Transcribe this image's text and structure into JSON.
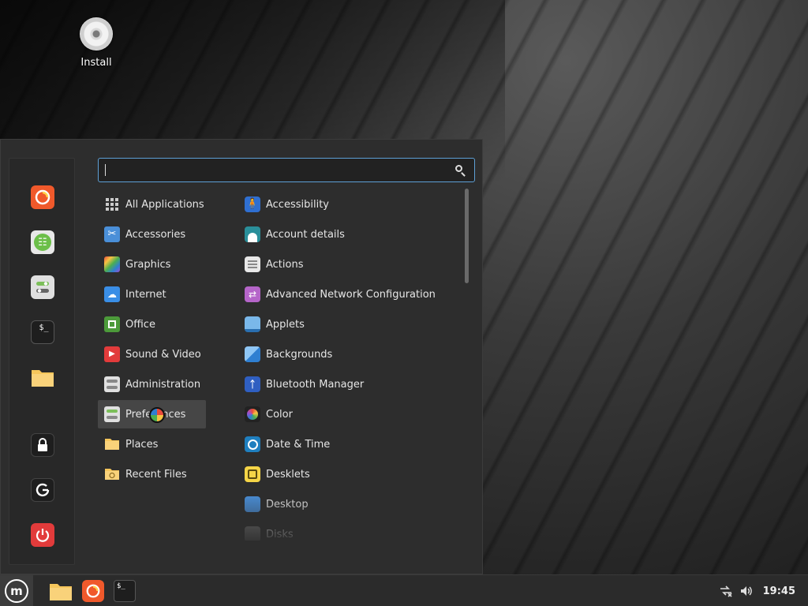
{
  "desktop": {
    "icons": [
      {
        "label": "Install",
        "icon": "disc-icon"
      }
    ]
  },
  "search": {
    "value": "",
    "placeholder": ""
  },
  "favorites": [
    {
      "name": "firefox",
      "icon": "firefox-icon",
      "color": "#f0592b"
    },
    {
      "name": "software-manager",
      "icon": "software-manager-icon",
      "color": "#6cbf49"
    },
    {
      "name": "system-settings",
      "icon": "settings-toggle-icon",
      "color": "#e0e0e0"
    },
    {
      "name": "terminal",
      "icon": "terminal-icon",
      "color": "#1e1e1e"
    },
    {
      "name": "files",
      "icon": "folder-icon",
      "color": "#f6c65b"
    },
    {
      "name": "lock-screen",
      "icon": "lock-icon",
      "color": "#1e1e1e"
    },
    {
      "name": "logout",
      "icon": "logout-icon",
      "color": "#1e1e1e"
    },
    {
      "name": "shutdown",
      "icon": "power-icon",
      "color": "#e23b3b"
    }
  ],
  "categories": [
    {
      "label": "All Applications",
      "icon": "grid-icon"
    },
    {
      "label": "Accessories",
      "icon": "scissors-icon"
    },
    {
      "label": "Graphics",
      "icon": "graphics-icon"
    },
    {
      "label": "Internet",
      "icon": "cloud-icon"
    },
    {
      "label": "Office",
      "icon": "office-icon"
    },
    {
      "label": "Sound & Video",
      "icon": "play-icon"
    },
    {
      "label": "Administration",
      "icon": "admin-toggle-icon"
    },
    {
      "label": "Preferences",
      "icon": "preferences-toggle-icon",
      "selected": true
    },
    {
      "label": "Places",
      "icon": "folder-icon"
    },
    {
      "label": "Recent Files",
      "icon": "recent-folder-icon"
    }
  ],
  "apps": [
    {
      "label": "Accessibility",
      "icon": "accessibility-icon"
    },
    {
      "label": "Account details",
      "icon": "account-icon"
    },
    {
      "label": "Actions",
      "icon": "actions-icon"
    },
    {
      "label": "Advanced Network Configuration",
      "icon": "network-icon"
    },
    {
      "label": "Applets",
      "icon": "applets-icon"
    },
    {
      "label": "Backgrounds",
      "icon": "backgrounds-icon"
    },
    {
      "label": "Bluetooth Manager",
      "icon": "bluetooth-icon"
    },
    {
      "label": "Color",
      "icon": "color-icon"
    },
    {
      "label": "Date & Time",
      "icon": "clock-icon"
    },
    {
      "label": "Desklets",
      "icon": "desklets-icon"
    },
    {
      "label": "Desktop",
      "icon": "desktop-icon"
    },
    {
      "label": "Disks",
      "icon": "disks-icon"
    }
  ],
  "panel": {
    "launchers": [
      {
        "name": "files",
        "icon": "folder-icon"
      },
      {
        "name": "firefox",
        "icon": "firefox-icon"
      },
      {
        "name": "terminal",
        "icon": "terminal-icon"
      }
    ],
    "clock": "19:45"
  },
  "colors": {
    "accent": "#5ea0d6",
    "selected": "#464646",
    "menu_bg": "#2d2d2d"
  }
}
